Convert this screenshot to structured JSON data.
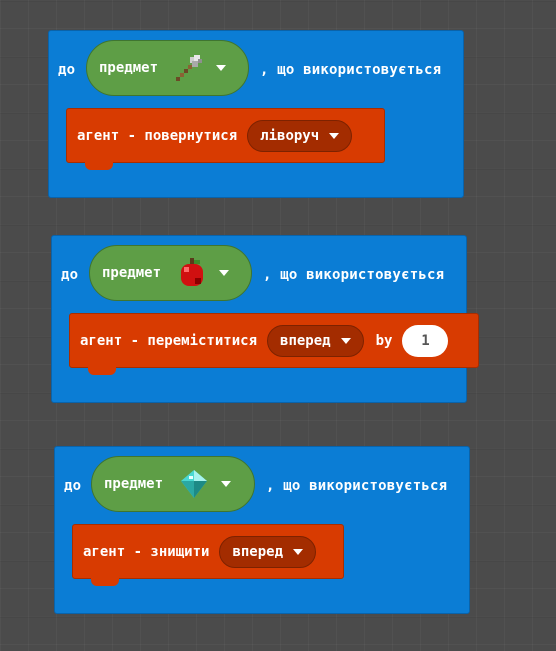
{
  "colors": {
    "event_block": "#0b7dd5",
    "item_pill": "#5e9e46",
    "agent_command": "#d83b01",
    "dropdown_pill": "#a32c00",
    "background": "#4b4b4b"
  },
  "blocks": [
    {
      "do_label": "до",
      "item_label": "предмет",
      "item_icon": "shovel-icon",
      "used_label": ", що використовується",
      "command": {
        "label": "агент - повернутися",
        "direction": "ліворуч"
      }
    },
    {
      "do_label": "до",
      "item_label": "предмет",
      "item_icon": "apple-icon",
      "used_label": ", що використовується",
      "command": {
        "label": "агент - переміститися",
        "direction": "вперед",
        "by_label": "by",
        "amount": "1"
      }
    },
    {
      "do_label": "до",
      "item_label": "предмет",
      "item_icon": "diamond-icon",
      "used_label": ", що використовується",
      "command": {
        "label": "агент - знищити",
        "direction": "вперед"
      }
    }
  ]
}
